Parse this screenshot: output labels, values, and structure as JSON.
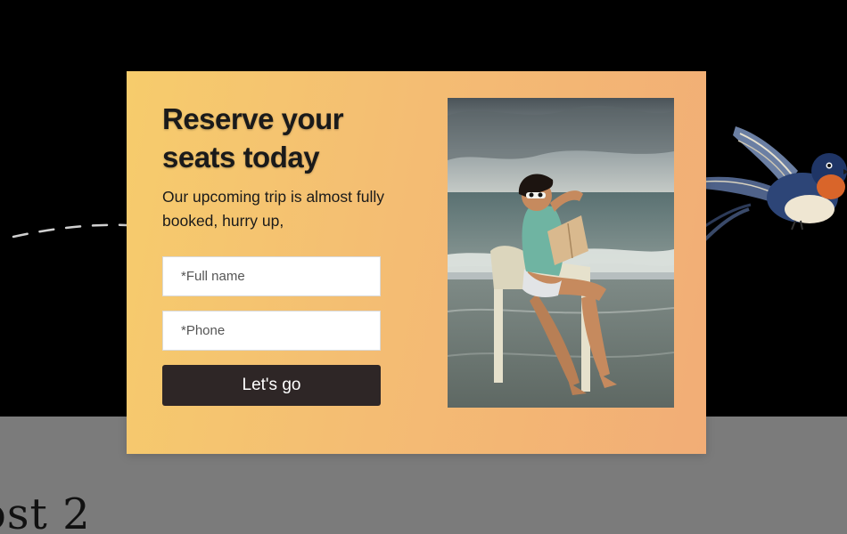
{
  "background": {
    "hero_color": "#000000",
    "lower_color": "#7b7b7b",
    "post_title": "ost 2"
  },
  "modal": {
    "heading": "Reserve your seats today",
    "subtext": "Our upcoming trip is almost fully booked, hurry up,",
    "name_placeholder": "*Full name",
    "phone_placeholder": "*Phone",
    "submit_label": "Let's go",
    "gradient_start": "#f6cc6c",
    "gradient_end": "#f2ad76",
    "button_color": "#2e2626",
    "image_alt": "woman-reading-on-beach-chair"
  },
  "decorations": {
    "bird_icon": "swallow-bird-icon",
    "path_icon": "dashed-flight-path"
  }
}
